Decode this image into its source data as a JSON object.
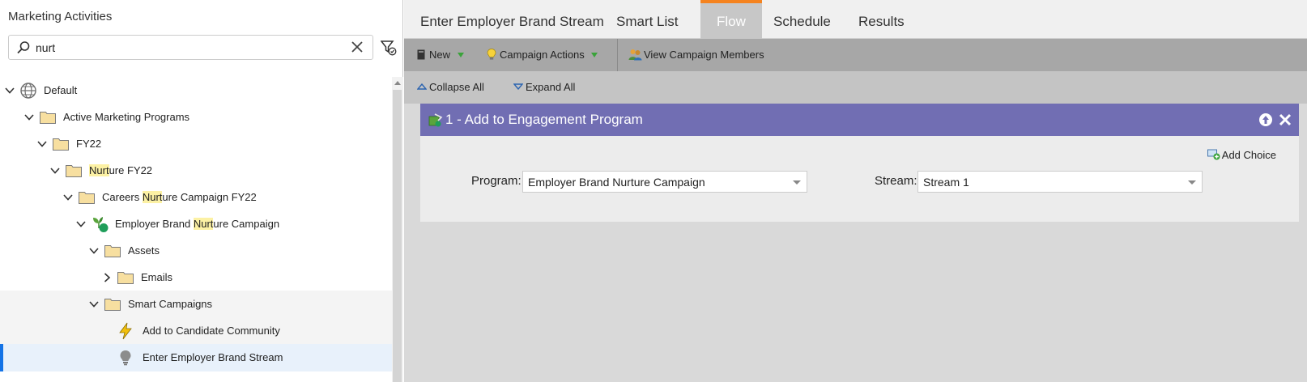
{
  "left_panel": {
    "title": "Marketing Activities",
    "search_value": "nurt",
    "tree": [
      {
        "label": "Default",
        "icon": "globe-icon",
        "expanded": true
      },
      {
        "label": "Active Marketing Programs",
        "icon": "folder-icon",
        "expanded": true
      },
      {
        "label": "FY22",
        "icon": "folder-icon",
        "expanded": true
      },
      {
        "pre": "",
        "hl": "Nurt",
        "post": "ure FY22",
        "icon": "folder-icon",
        "expanded": true
      },
      {
        "pre": "Careers ",
        "hl": "Nurt",
        "post": "ure Campaign FY22",
        "icon": "folder-icon",
        "expanded": true
      },
      {
        "pre": "Employer Brand ",
        "hl": "Nurt",
        "post": "ure Campaign",
        "icon": "nurture-program-icon",
        "expanded": true
      },
      {
        "label": "Assets",
        "icon": "folder-icon",
        "expanded": true
      },
      {
        "label": "Emails",
        "icon": "folder-icon",
        "expanded": false
      },
      {
        "label": "Smart Campaigns",
        "icon": "folder-icon",
        "expanded": true
      },
      {
        "label": "Add to Candidate Community",
        "icon": "lightning-icon"
      },
      {
        "label": "Enter Employer Brand Stream",
        "icon": "lightbulb-icon",
        "selected": true
      }
    ]
  },
  "tabs": [
    {
      "label": "Enter Employer Brand Stream"
    },
    {
      "label": "Smart List"
    },
    {
      "label": "Flow",
      "active": true
    },
    {
      "label": "Schedule"
    },
    {
      "label": "Results"
    }
  ],
  "toolbar": {
    "new_label": "New",
    "campaign_actions_label": "Campaign Actions",
    "view_members_label": "View Campaign Members",
    "collapse_all_label": "Collapse All",
    "expand_all_label": "Expand All"
  },
  "flow_step": {
    "title": "1 - Add to Engagement Program",
    "add_choice_label": "Add Choice",
    "program_label": "Program:",
    "program_value": "Employer Brand Nurture Campaign",
    "stream_label": "Stream:",
    "stream_value": "Stream 1"
  },
  "colors": {
    "accent_orange": "#f5831f",
    "step_header": "#716eb3",
    "highlight": "#fcf1a4",
    "selection": "#1473e6"
  }
}
